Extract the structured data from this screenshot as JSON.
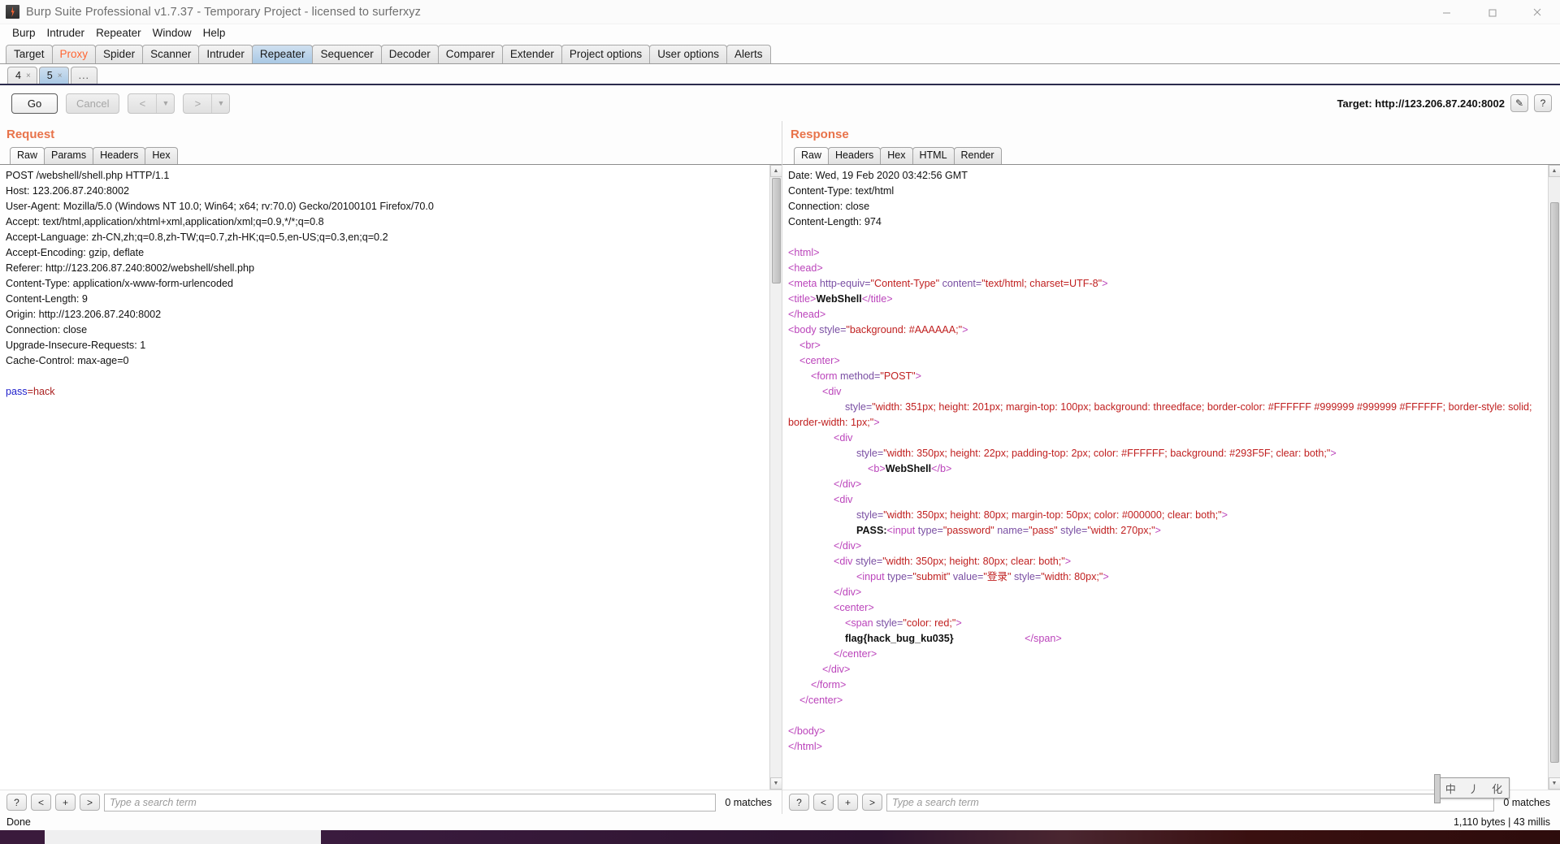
{
  "window": {
    "title": "Burp Suite Professional v1.7.37 - Temporary Project - licensed to surferxyz",
    "minimize": "—",
    "maximize": "❐",
    "close": "✕"
  },
  "menu": [
    "Burp",
    "Intruder",
    "Repeater",
    "Window",
    "Help"
  ],
  "main_tabs": [
    {
      "label": "Target",
      "state": "normal"
    },
    {
      "label": "Proxy",
      "state": "alert"
    },
    {
      "label": "Spider",
      "state": "normal"
    },
    {
      "label": "Scanner",
      "state": "normal"
    },
    {
      "label": "Intruder",
      "state": "normal"
    },
    {
      "label": "Repeater",
      "state": "active"
    },
    {
      "label": "Sequencer",
      "state": "normal"
    },
    {
      "label": "Decoder",
      "state": "normal"
    },
    {
      "label": "Comparer",
      "state": "normal"
    },
    {
      "label": "Extender",
      "state": "normal"
    },
    {
      "label": "Project options",
      "state": "normal"
    },
    {
      "label": "User options",
      "state": "normal"
    },
    {
      "label": "Alerts",
      "state": "normal"
    }
  ],
  "repeater_tabs": [
    {
      "label": "4",
      "close": "×",
      "state": "normal"
    },
    {
      "label": "5",
      "close": "×",
      "state": "active"
    },
    {
      "label": "...",
      "state": "more"
    }
  ],
  "actions": {
    "go": "Go",
    "cancel": "Cancel",
    "back": "<",
    "forward": ">",
    "arrow": "▼"
  },
  "target": {
    "label": "Target: http://123.206.87.240:8002",
    "edit_icon": "✎",
    "help_icon": "?"
  },
  "request": {
    "title": "Request",
    "tabs": [
      "Raw",
      "Params",
      "Headers",
      "Hex"
    ],
    "active_tab": "Raw",
    "headers": [
      "POST /webshell/shell.php HTTP/1.1",
      "Host: 123.206.87.240:8002",
      "User-Agent: Mozilla/5.0 (Windows NT 10.0; Win64; x64; rv:70.0) Gecko/20100101 Firefox/70.0",
      "Accept: text/html,application/xhtml+xml,application/xml;q=0.9,*/*;q=0.8",
      "Accept-Language: zh-CN,zh;q=0.8,zh-TW;q=0.7,zh-HK;q=0.5,en-US;q=0.3,en;q=0.2",
      "Accept-Encoding: gzip, deflate",
      "Referer: http://123.206.87.240:8002/webshell/shell.php",
      "Content-Type: application/x-www-form-urlencoded",
      "Content-Length: 9",
      "Origin: http://123.206.87.240:8002",
      "Connection: close",
      "Upgrade-Insecure-Requests: 1",
      "Cache-Control: max-age=0"
    ],
    "body_param_name": "pass",
    "body_param_value": "=hack",
    "search_placeholder": "Type a search term",
    "matches": "0 matches",
    "search_buttons": [
      "?",
      "<",
      "+",
      ">"
    ]
  },
  "response": {
    "title": "Response",
    "tabs": [
      "Raw",
      "Headers",
      "Hex",
      "HTML",
      "Render"
    ],
    "active_tab": "Raw",
    "headers": [
      "Date: Wed, 19 Feb 2020 03:42:56 GMT",
      "Content-Type: text/html",
      "Connection: close",
      "Content-Length: 974"
    ],
    "body_lines": [
      {
        "indent": 0,
        "parts": [
          {
            "t": "tag",
            "s": "<html>"
          }
        ]
      },
      {
        "indent": 0,
        "parts": [
          {
            "t": "tag",
            "s": "<head>"
          }
        ]
      },
      {
        "indent": 0,
        "parts": [
          {
            "t": "tag",
            "s": "<meta "
          },
          {
            "t": "attr",
            "s": "http-equiv="
          },
          {
            "t": "val",
            "s": "\"Content-Type\" "
          },
          {
            "t": "attr",
            "s": "content="
          },
          {
            "t": "val",
            "s": "\"text/html; charset=UTF-8\""
          },
          {
            "t": "tag",
            "s": ">"
          }
        ]
      },
      {
        "indent": 0,
        "parts": [
          {
            "t": "tag",
            "s": "<title>"
          },
          {
            "t": "txt",
            "s": "WebShell"
          },
          {
            "t": "tag",
            "s": "</title>"
          }
        ]
      },
      {
        "indent": 0,
        "parts": [
          {
            "t": "tag",
            "s": "</head>"
          }
        ]
      },
      {
        "indent": 0,
        "parts": [
          {
            "t": "tag",
            "s": "<body "
          },
          {
            "t": "attr",
            "s": "style="
          },
          {
            "t": "val",
            "s": "\"background: #AAAAAA;\""
          },
          {
            "t": "tag",
            "s": ">"
          }
        ]
      },
      {
        "indent": 1,
        "parts": [
          {
            "t": "tag",
            "s": "<br>"
          }
        ]
      },
      {
        "indent": 1,
        "parts": [
          {
            "t": "tag",
            "s": "<center>"
          }
        ]
      },
      {
        "indent": 2,
        "parts": [
          {
            "t": "tag",
            "s": "<form "
          },
          {
            "t": "attr",
            "s": "method="
          },
          {
            "t": "val",
            "s": "\"POST\""
          },
          {
            "t": "tag",
            "s": ">"
          }
        ]
      },
      {
        "indent": 3,
        "parts": [
          {
            "t": "tag",
            "s": "<div"
          }
        ]
      },
      {
        "indent": 5,
        "parts": [
          {
            "t": "attr",
            "s": "style="
          },
          {
            "t": "val",
            "s": "\"width: 351px; height: 201px; margin-top: 100px; background: threedface; border-color: #FFFFFF #999999 #999999 #FFFFFF; border-style: solid; border-width: 1px;\""
          },
          {
            "t": "tag",
            "s": ">"
          }
        ]
      },
      {
        "indent": 4,
        "parts": [
          {
            "t": "tag",
            "s": "<div"
          }
        ]
      },
      {
        "indent": 6,
        "parts": [
          {
            "t": "attr",
            "s": "style="
          },
          {
            "t": "val",
            "s": "\"width: 350px; height: 22px; padding-top: 2px; color: #FFFFFF; background: #293F5F; clear: both;\""
          },
          {
            "t": "tag",
            "s": ">"
          }
        ]
      },
      {
        "indent": 7,
        "parts": [
          {
            "t": "tag",
            "s": "<b>"
          },
          {
            "t": "txt",
            "s": "WebShell"
          },
          {
            "t": "tag",
            "s": "</b>"
          }
        ]
      },
      {
        "indent": 4,
        "parts": [
          {
            "t": "tag",
            "s": "</div>"
          }
        ]
      },
      {
        "indent": 4,
        "parts": [
          {
            "t": "tag",
            "s": "<div"
          }
        ]
      },
      {
        "indent": 6,
        "parts": [
          {
            "t": "attr",
            "s": "style="
          },
          {
            "t": "val",
            "s": "\"width: 350px; height: 80px; margin-top: 50px; color: #000000; clear: both;\""
          },
          {
            "t": "tag",
            "s": ">"
          }
        ]
      },
      {
        "indent": 6,
        "parts": [
          {
            "t": "txt",
            "s": "PASS:"
          },
          {
            "t": "tag",
            "s": "<input "
          },
          {
            "t": "attr",
            "s": "type="
          },
          {
            "t": "val",
            "s": "\"password\" "
          },
          {
            "t": "attr",
            "s": "name="
          },
          {
            "t": "val",
            "s": "\"pass\" "
          },
          {
            "t": "attr",
            "s": "style="
          },
          {
            "t": "val",
            "s": "\"width: 270px;\""
          },
          {
            "t": "tag",
            "s": ">"
          }
        ]
      },
      {
        "indent": 4,
        "parts": [
          {
            "t": "tag",
            "s": "</div>"
          }
        ]
      },
      {
        "indent": 4,
        "parts": [
          {
            "t": "tag",
            "s": "<div "
          },
          {
            "t": "attr",
            "s": "style="
          },
          {
            "t": "val",
            "s": "\"width: 350px; height: 80px; clear: both;\""
          },
          {
            "t": "tag",
            "s": ">"
          }
        ]
      },
      {
        "indent": 6,
        "parts": [
          {
            "t": "tag",
            "s": "<input "
          },
          {
            "t": "attr",
            "s": "type="
          },
          {
            "t": "val",
            "s": "\"submit\" "
          },
          {
            "t": "attr",
            "s": "value="
          },
          {
            "t": "val",
            "s": "\"登录\" "
          },
          {
            "t": "attr",
            "s": "style="
          },
          {
            "t": "val",
            "s": "\"width: 80px;\""
          },
          {
            "t": "tag",
            "s": ">"
          }
        ]
      },
      {
        "indent": 4,
        "parts": [
          {
            "t": "tag",
            "s": "</div>"
          }
        ]
      },
      {
        "indent": 4,
        "parts": [
          {
            "t": "tag",
            "s": "<center>"
          }
        ]
      },
      {
        "indent": 5,
        "parts": [
          {
            "t": "tag",
            "s": "<span "
          },
          {
            "t": "attr",
            "s": "style="
          },
          {
            "t": "val",
            "s": "\"color: red;\""
          },
          {
            "t": "tag",
            "s": ">"
          }
        ]
      },
      {
        "indent": 5,
        "parts": [
          {
            "t": "txt",
            "s": "flag{hack_bug_ku035}"
          },
          {
            "t": "pad",
            "s": "                         "
          },
          {
            "t": "tag",
            "s": "</span>"
          }
        ]
      },
      {
        "indent": 4,
        "parts": [
          {
            "t": "tag",
            "s": "</center>"
          }
        ]
      },
      {
        "indent": 3,
        "parts": [
          {
            "t": "tag",
            "s": "</div>"
          }
        ]
      },
      {
        "indent": 2,
        "parts": [
          {
            "t": "tag",
            "s": "</form>"
          }
        ]
      },
      {
        "indent": 1,
        "parts": [
          {
            "t": "tag",
            "s": "</center>"
          }
        ]
      },
      {
        "indent": 0,
        "parts": []
      },
      {
        "indent": 0,
        "parts": [
          {
            "t": "tag",
            "s": "</body>"
          }
        ]
      },
      {
        "indent": 0,
        "parts": [
          {
            "t": "tag",
            "s": "</html>"
          }
        ]
      }
    ],
    "search_placeholder": "Type a search term",
    "matches": "0 matches",
    "search_buttons": [
      "?",
      "<",
      "+",
      ">"
    ]
  },
  "status": {
    "left": "Done",
    "right": "1,110 bytes | 43 millis"
  },
  "ime": {
    "cells": [
      "中",
      "丿",
      "化"
    ]
  },
  "colors": {
    "accent_orange": "#e8734a",
    "proxy_alert": "#ff6633",
    "tab_active": "#a9c8e4",
    "tag_purple": "#bb44bb",
    "attr_purple": "#7a4fa3",
    "value_red": "#c02020",
    "param_blue": "#2222cc"
  }
}
